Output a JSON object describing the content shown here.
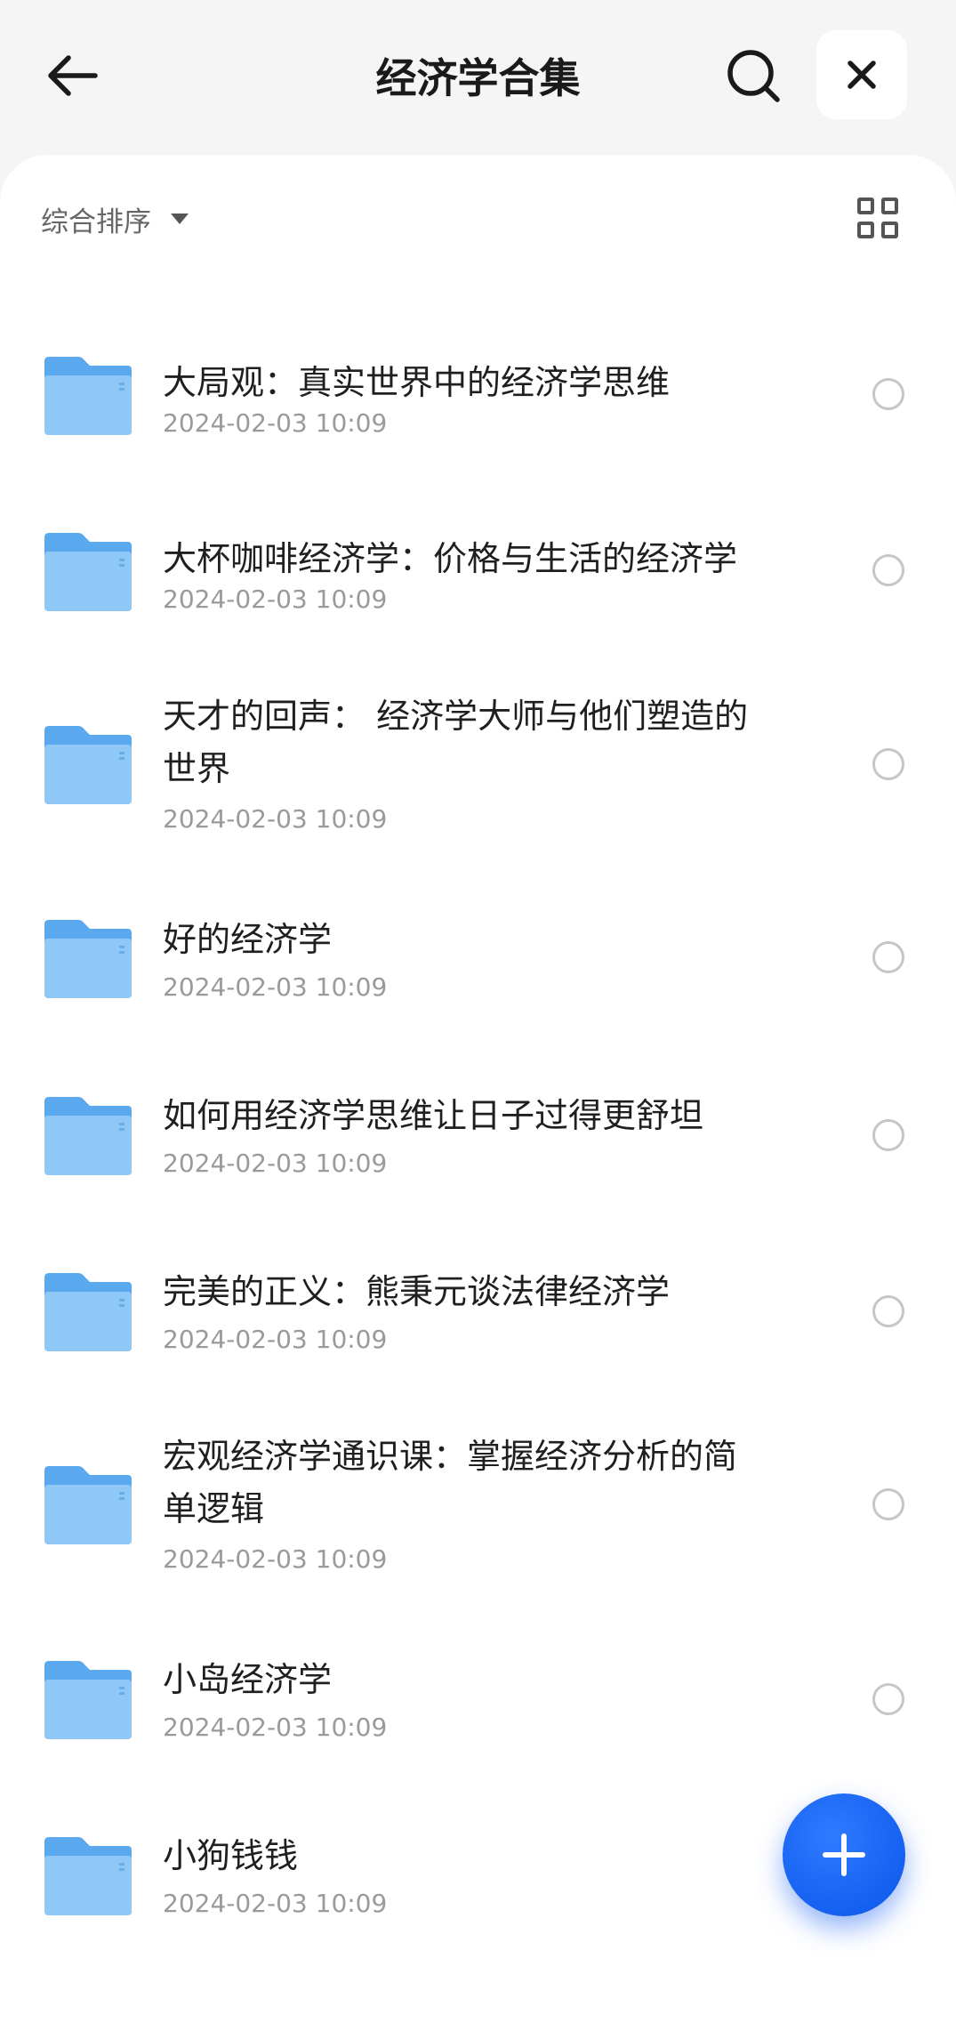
{
  "header": {
    "title": "经济学合集",
    "back_icon": "arrow-left-icon",
    "search_icon": "search-icon",
    "close_icon": "close-icon"
  },
  "toolbar": {
    "sort_label": "综合排序",
    "sort_icon": "caret-down-icon",
    "view_icon": "grid-view-icon"
  },
  "folders": [
    {
      "title": "大局观：真实世界中的经济学思维",
      "date": "2024-02-03 10:09"
    },
    {
      "title": "大杯咖啡经济学：价格与生活的经济学",
      "date": "2024-02-03 10:09"
    },
    {
      "title_lines": [
        "天才的回声： 经济学大师与他们塑造的",
        "世界"
      ],
      "date": "2024-02-03 10:09"
    },
    {
      "title": "好的经济学",
      "date": "2024-02-03 10:09"
    },
    {
      "title": "如何用经济学思维让日子过得更舒坦",
      "date": "2024-02-03 10:09"
    },
    {
      "title": "完美的正义：熊秉元谈法律经济学",
      "date": "2024-02-03 10:09"
    },
    {
      "title_lines": [
        "宏观经济学通识课：掌握经济分析的简",
        "单逻辑"
      ],
      "date": "2024-02-03 10:09"
    },
    {
      "title": "小岛经济学",
      "date": "2024-02-03 10:09"
    },
    {
      "title": "小狗钱钱",
      "date": "2024-02-03 10:09"
    }
  ],
  "colors": {
    "accent": "#1560f0",
    "folder": "#64b0f2"
  },
  "fab_icon": "plus-icon"
}
